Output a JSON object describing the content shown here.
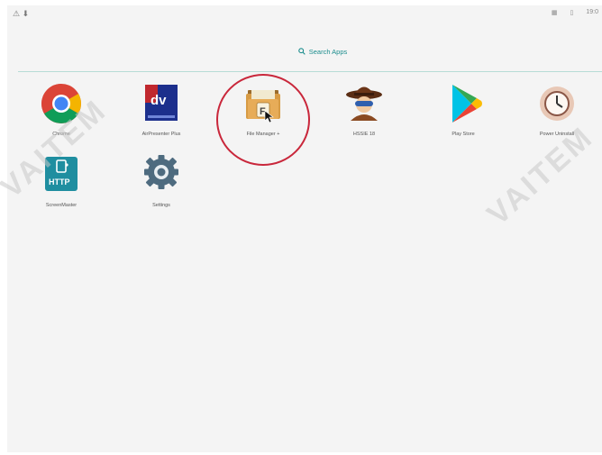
{
  "status_bar": {
    "left_text": "⚠ ⬇",
    "icons": [
      "▦",
      "▯"
    ],
    "time": "19:0"
  },
  "search": {
    "label": "Search Apps"
  },
  "apps": [
    {
      "label": "Chrome"
    },
    {
      "label": "AirPresenter Plus"
    },
    {
      "label": "File Manager +"
    },
    {
      "label": "HSSIE 18"
    },
    {
      "label": "Play Store"
    },
    {
      "label": "Power Uninstall"
    },
    {
      "label": "ScreenMaster"
    },
    {
      "label": "Settings"
    }
  ],
  "watermark": "VAITEM",
  "colors": {
    "accent": "#1a8c8c",
    "highlight_ring": "#c9273b"
  }
}
